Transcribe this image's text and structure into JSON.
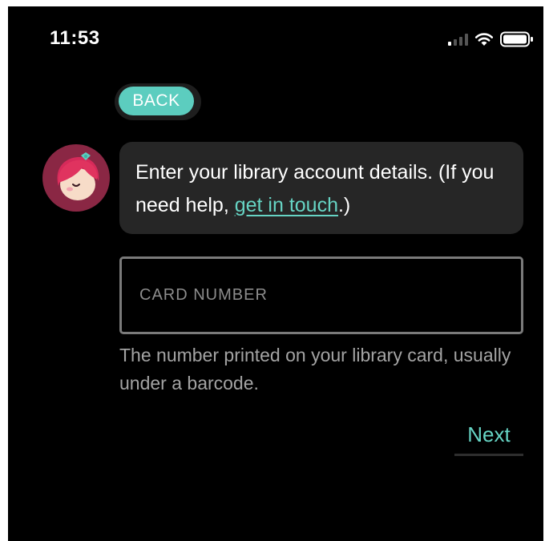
{
  "status_bar": {
    "time": "11:53",
    "icons": [
      "cellular-signal-icon",
      "wifi-icon",
      "battery-icon"
    ]
  },
  "back_button": {
    "label": "BACK"
  },
  "avatar": {
    "icon": "librarian-avatar-icon"
  },
  "message": {
    "text_before": "Enter your library account details. (If you need help, ",
    "link_text": "get in touch",
    "text_after": ".)"
  },
  "card_field": {
    "placeholder": "CARD NUMBER",
    "value": "",
    "hint": "The number printed on your library card, usually under a barcode."
  },
  "next_button": {
    "label": "Next"
  },
  "colors": {
    "accent": "#5ccdbf",
    "link": "#66d4c4",
    "background": "#000000",
    "bubble": "#262626",
    "avatar_bg": "#8a2744"
  }
}
